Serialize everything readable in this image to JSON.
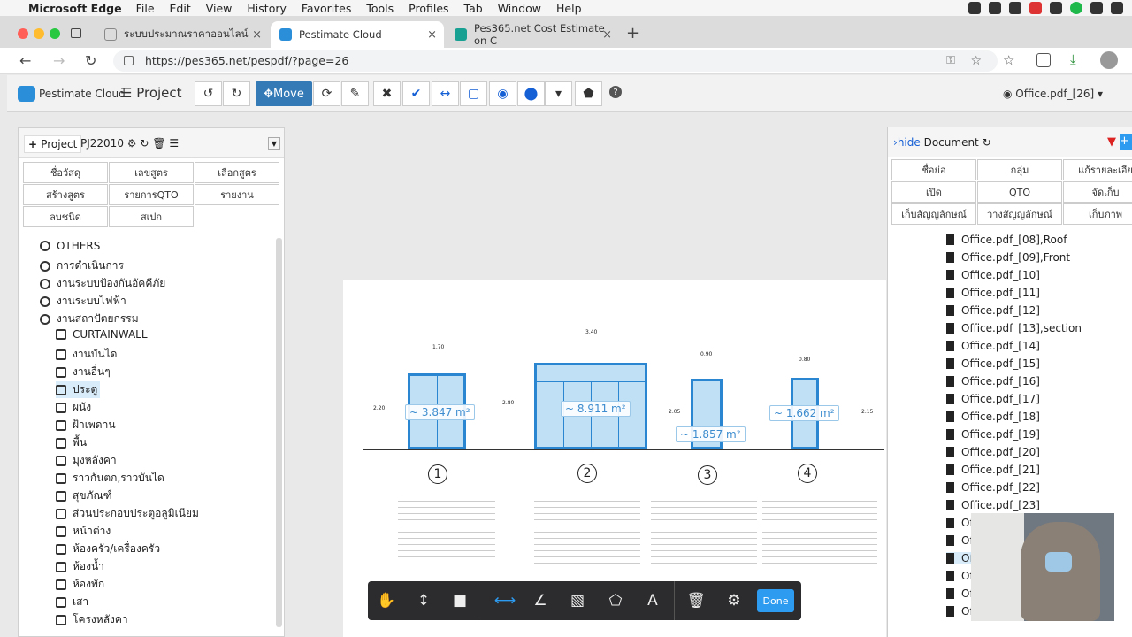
{
  "menubar": {
    "app_name": "Microsoft Edge",
    "items": [
      "File",
      "Edit",
      "View",
      "History",
      "Favorites",
      "Tools",
      "Profiles",
      "Tab",
      "Window",
      "Help"
    ]
  },
  "tabs": [
    {
      "label": "ระบบประมาณราคาออนไลน์",
      "active": false
    },
    {
      "label": "Pestimate Cloud",
      "active": true
    },
    {
      "label": "Pes365.net Cost Estimate on C",
      "active": false
    }
  ],
  "address": {
    "url": "https://pes365.net/pespdf/?page=26"
  },
  "app": {
    "brand": "Pestimate Cloud",
    "project_menu": "Project",
    "move_label": "Move",
    "document_label": "Office.pdf_[26]"
  },
  "left_panel": {
    "project_button": "Project",
    "project_code": "PJ22010",
    "buttons": [
      "ชื่อวัสดุ",
      "เลขสูตร",
      "เลือกสูตร",
      "สร้างสูตร",
      "รายการQTO",
      "รายงาน",
      "ลบชนิด",
      "สเปก"
    ],
    "tree": [
      {
        "label": "OTHERS",
        "level": 0
      },
      {
        "label": "การดำเนินการ",
        "level": 0
      },
      {
        "label": "งานระบบป้องกันอัคคีภัย",
        "level": 0
      },
      {
        "label": "งานระบบไฟฟ้า",
        "level": 0
      },
      {
        "label": "งานสถาปัตยกรรม",
        "level": 0
      },
      {
        "label": "CURTAINWALL",
        "level": 1
      },
      {
        "label": "งานบันได",
        "level": 1
      },
      {
        "label": "งานอื่นๆ",
        "level": 1
      },
      {
        "label": "ประตู",
        "level": 1,
        "selected": true
      },
      {
        "label": "ผนัง",
        "level": 1
      },
      {
        "label": "ฝ้าเพดาน",
        "level": 1
      },
      {
        "label": "พื้น",
        "level": 1
      },
      {
        "label": "มุงหลังคา",
        "level": 1
      },
      {
        "label": "ราวกันตก,ราวบันได",
        "level": 1
      },
      {
        "label": "สุขภัณฑ์",
        "level": 1
      },
      {
        "label": "ส่วนประกอบประตูอลูมิเนียม",
        "level": 1
      },
      {
        "label": "หน้าต่าง",
        "level": 1
      },
      {
        "label": "ห้องครัว/เครื่องครัว",
        "level": 1
      },
      {
        "label": "ห้องน้ำ",
        "level": 1
      },
      {
        "label": "ห้องพัก",
        "level": 1
      },
      {
        "label": "เสา",
        "level": 1
      },
      {
        "label": "โครงหลังคา",
        "level": 1
      }
    ]
  },
  "drawing": {
    "measurements": [
      "~ 3.847 m²",
      "~ 8.911 m²",
      "~ 1.857 m²",
      "~ 1.662 m²"
    ],
    "numbers": [
      "1",
      "2",
      "3",
      "4"
    ],
    "dims": [
      "1.70",
      "3.40",
      "0.90",
      "0.80",
      "2.20",
      "2.80",
      "2.05",
      "2.15"
    ]
  },
  "bottom_toolbar": {
    "done_label": "Done"
  },
  "right_panel": {
    "hide_label": "hide",
    "doc_label": "Document",
    "buttons": [
      "ชื่อย่อ",
      "กลุ่ม",
      "แก้รายละเอีย",
      "เปิด",
      "QTO",
      "จัดเก็บ",
      "เก็บสัญญลักษณ์",
      "วางสัญญลักษณ์",
      "เก็บภาพ"
    ],
    "files": [
      "Office.pdf_[08],Roof",
      "Office.pdf_[09],Front",
      "Office.pdf_[10]",
      "Office.pdf_[11]",
      "Office.pdf_[12]",
      "Office.pdf_[13],section",
      "Office.pdf_[14]",
      "Office.pdf_[15]",
      "Office.pdf_[16]",
      "Office.pdf_[17]",
      "Office.pdf_[18]",
      "Office.pdf_[19]",
      "Office.pdf_[20]",
      "Office.pdf_[21]",
      "Office.pdf_[22]",
      "Office.pdf_[23]",
      "Off",
      "Off",
      "Off",
      "Off",
      "Off",
      "Off"
    ]
  },
  "colors": {
    "accent": "#337ab7",
    "measure": "#2a86d1",
    "done": "#2d9bf0"
  }
}
